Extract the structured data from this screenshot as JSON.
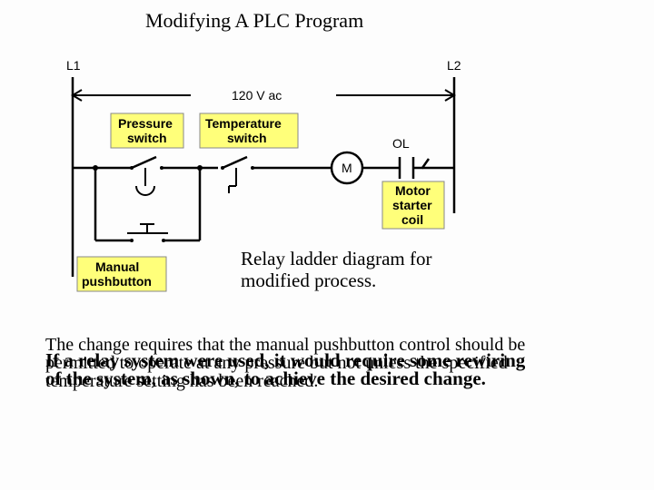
{
  "title": "Modifying A PLC Program",
  "rails": {
    "left": "L1",
    "right": "L2",
    "voltage": "120 V ac"
  },
  "components": {
    "pressure": {
      "l1": "Pressure",
      "l2": "switch"
    },
    "temperature": {
      "l1": "Temperature",
      "l2": "switch"
    },
    "motor": {
      "symbol": "M",
      "l1": "Motor",
      "l2": "starter",
      "l3": "coil",
      "ol": "OL"
    },
    "pushbutton": {
      "l1": "Manual",
      "l2": "pushbutton"
    }
  },
  "caption": {
    "l1": "Relay ladder diagram for",
    "l2": "modified process."
  },
  "para1": "The change requires that the manual pushbutton control should be permitted to operate at any pressure but not unless the specified temperature setting has been reached.",
  "para2": "If a relay system were used, it would require some rewiring of the system, as shown, to achieve the desired change."
}
